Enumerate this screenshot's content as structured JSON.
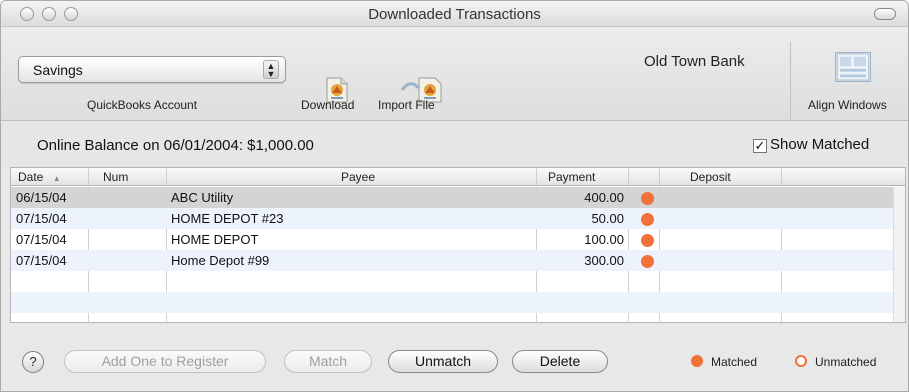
{
  "window": {
    "title": "Downloaded Transactions"
  },
  "toolbar": {
    "account_value": "Savings",
    "account_label": "QuickBooks Account",
    "download_label": "Download",
    "import_label": "Import File",
    "bank_name": "Old Town Bank",
    "align_label": "Align Windows"
  },
  "balance": {
    "text": "Online Balance on 06/01/2004: $1,000.00",
    "show_matched_label": "Show Matched",
    "show_matched_checked": true
  },
  "table": {
    "columns": [
      "Date",
      "Num",
      "Payee",
      "Payment",
      "Deposit"
    ],
    "sort_indicator": "▲",
    "rows": [
      {
        "date": "06/15/04",
        "num": "",
        "payee": "ABC Utility",
        "payment": "400.00",
        "deposit": "",
        "matched": true
      },
      {
        "date": "07/15/04",
        "num": "",
        "payee": "HOME DEPOT #23",
        "payment": "50.00",
        "deposit": "",
        "matched": true
      },
      {
        "date": "07/15/04",
        "num": "",
        "payee": "HOME DEPOT",
        "payment": "100.00",
        "deposit": "",
        "matched": true
      },
      {
        "date": "07/15/04",
        "num": "",
        "payee": "Home Depot #99",
        "payment": "300.00",
        "deposit": "",
        "matched": true
      }
    ]
  },
  "buttons": {
    "help": "?",
    "add_to_register": "Add One to Register",
    "match": "Match",
    "unmatch": "Unmatch",
    "delete": "Delete"
  },
  "legend": {
    "matched": "Matched",
    "unmatched": "Unmatched"
  },
  "colors": {
    "matched_dot": "#f07238",
    "selected_row": "#d4d4d4",
    "alt_row": "#edf3fc"
  }
}
